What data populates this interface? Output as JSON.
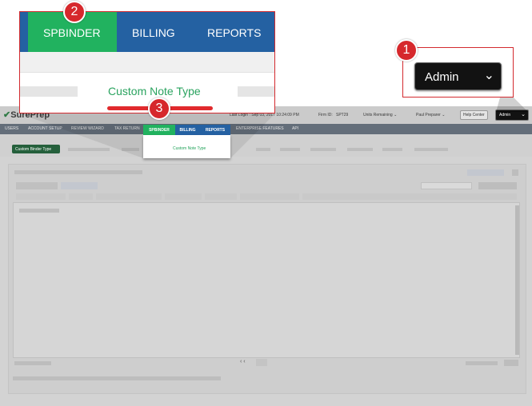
{
  "app": {
    "logo": "SurePrep",
    "last_login": "Last Login : Sep 03, 2017 10:24:09 PM",
    "firm_id_label": "Firm ID:",
    "firm_id": "SPT29",
    "units_remaining": "Units Remaining",
    "user": "Paul Preparer",
    "help_center": "Help Center",
    "role": "Admin"
  },
  "nav": {
    "items": [
      "USERS",
      "ACCOUNT SETUP",
      "REVIEW WIZARD",
      "TAX RETURN",
      "SPBINDER",
      "BILLING",
      "REPORTS",
      "ENTERPRISE FEATURES",
      "API"
    ]
  },
  "submenu": {
    "custom_binder_type": "Custom Binder Type",
    "custom_note_type": "Custom Note Type"
  },
  "zoom": {
    "tabs": [
      "SPBINDER",
      "BILLING",
      "REPORTS"
    ],
    "selected_item": "Custom Note Type"
  },
  "callouts": {
    "admin_label": "Admin",
    "badges": [
      "1",
      "2",
      "3"
    ]
  },
  "colors": {
    "nav_blue": "#2461a2",
    "active_green": "#21b25f",
    "callout_red": "#d32a2f"
  }
}
